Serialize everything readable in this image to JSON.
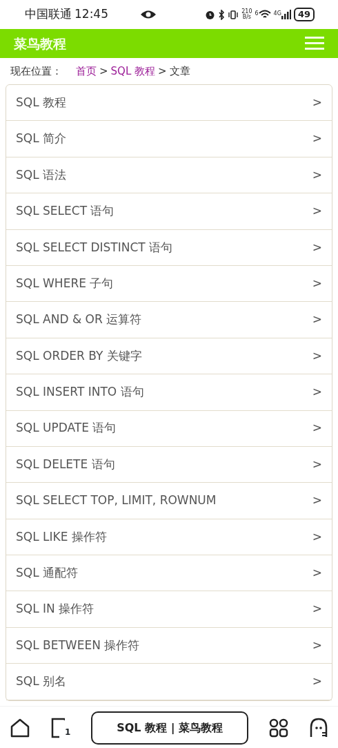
{
  "status_bar": {
    "carrier": "中国联通",
    "time": "12:45",
    "network_speed": [
      "210",
      "B/s"
    ],
    "wifi_label": "6",
    "signal_label": "4G",
    "battery": "49"
  },
  "header": {
    "title": "菜鸟教程"
  },
  "breadcrumb": {
    "label": "现在位置：",
    "items": [
      {
        "text": "首页",
        "kind": "link"
      },
      {
        "text": ">",
        "kind": "sep"
      },
      {
        "text": "SQL 教程",
        "kind": "link"
      },
      {
        "text": ">",
        "kind": "sep"
      },
      {
        "text": "文章",
        "kind": "current"
      }
    ]
  },
  "lessons": [
    {
      "title": "SQL 教程",
      "arrow": ">"
    },
    {
      "title": "SQL 简介",
      "arrow": ">"
    },
    {
      "title": "SQL 语法",
      "arrow": ">"
    },
    {
      "title": "SQL SELECT 语句",
      "arrow": ">"
    },
    {
      "title": "SQL SELECT DISTINCT 语句",
      "arrow": ">"
    },
    {
      "title": "SQL WHERE 子句",
      "arrow": ">"
    },
    {
      "title": "SQL AND & OR 运算符",
      "arrow": ">"
    },
    {
      "title": "SQL ORDER BY 关键字",
      "arrow": ">"
    },
    {
      "title": "SQL INSERT INTO 语句",
      "arrow": ">"
    },
    {
      "title": "SQL UPDATE 语句",
      "arrow": ">"
    },
    {
      "title": "SQL DELETE 语句",
      "arrow": ">"
    },
    {
      "title": "SQL SELECT TOP, LIMIT, ROWNUM",
      "arrow": ">"
    },
    {
      "title": "SQL LIKE 操作符",
      "arrow": ">"
    },
    {
      "title": "SQL 通配符",
      "arrow": ">"
    },
    {
      "title": "SQL IN 操作符",
      "arrow": ">"
    },
    {
      "title": "SQL BETWEEN 操作符",
      "arrow": ">"
    },
    {
      "title": "SQL 别名",
      "arrow": ">"
    }
  ],
  "bottom_bar": {
    "address": "SQL 教程 | 菜鸟教程",
    "tab_count": "1"
  }
}
